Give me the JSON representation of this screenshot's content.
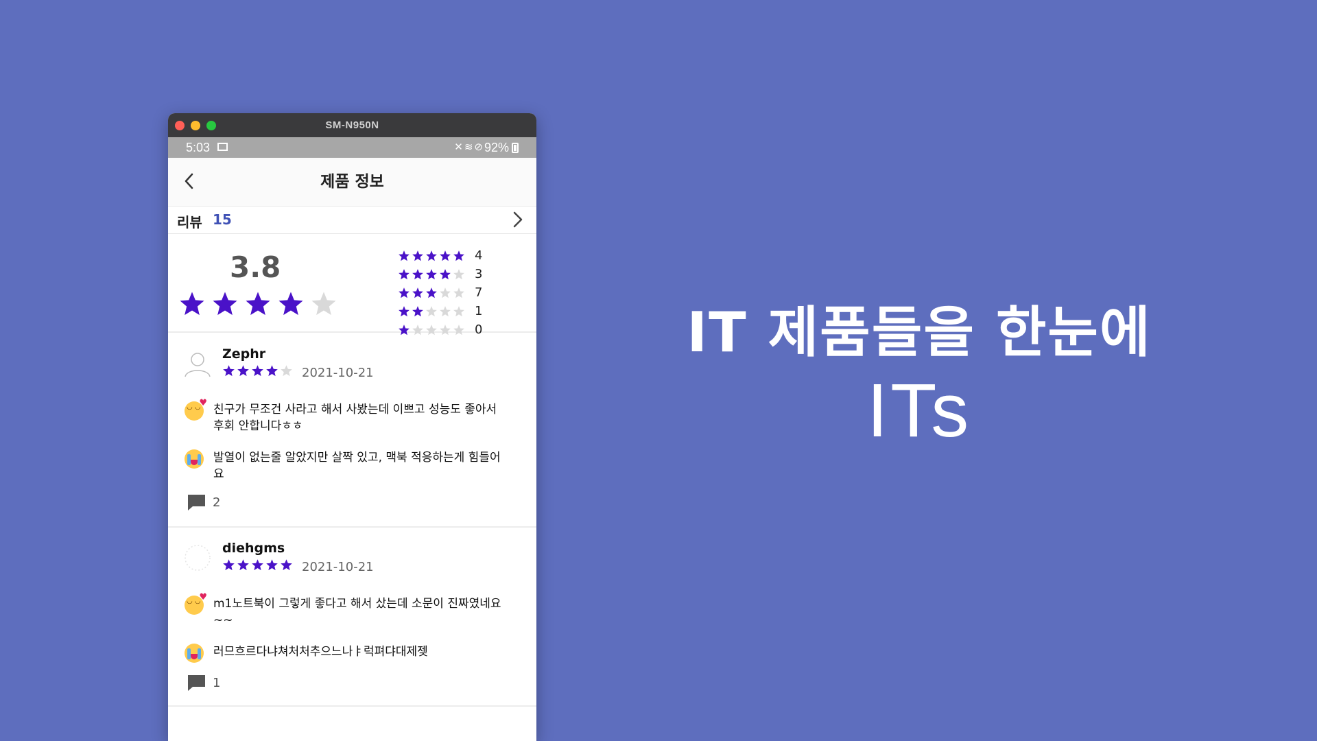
{
  "window": {
    "title": "SM-N950N"
  },
  "status_bar": {
    "time": "5:03",
    "battery": "92%"
  },
  "app_bar": {
    "title": "제품 정보"
  },
  "reviews_header": {
    "label": "리뷰",
    "count": "15"
  },
  "rating_summary": {
    "average": "3.8",
    "average_value": 3.8,
    "distribution": [
      {
        "stars": 5,
        "count": "4"
      },
      {
        "stars": 4,
        "count": "3"
      },
      {
        "stars": 3,
        "count": "7"
      },
      {
        "stars": 2,
        "count": "1"
      },
      {
        "stars": 1,
        "count": "0"
      }
    ]
  },
  "reviews": [
    {
      "user": "Zephr",
      "rating": 4,
      "date": "2021-10-21",
      "pros": "친구가 무조건 사라고 해서 사봤는데 이쁘고 성능도 좋아서 후회 안합니다ㅎㅎ",
      "cons": "발열이 없는줄 알았지만 살짝 있고, 맥북 적응하는게 힘들어요",
      "comments": "2"
    },
    {
      "user": "diehgms",
      "rating": 5,
      "date": "2021-10-21",
      "pros": "m1노트북이 그렇게 좋다고 해서 샀는데 소문이 진짜였네요~~",
      "cons": "러므흐르다냐쳐처처추으느나ㅑ럭펴댜대제젲",
      "comments": "1"
    }
  ],
  "tagline": "IT 제품들을 한눈에",
  "brand": "ITs",
  "colors": {
    "background": "#5e6ebe",
    "star": "#4a12c8",
    "star_empty": "#d9d9d9",
    "accent": "#3f51b5"
  }
}
